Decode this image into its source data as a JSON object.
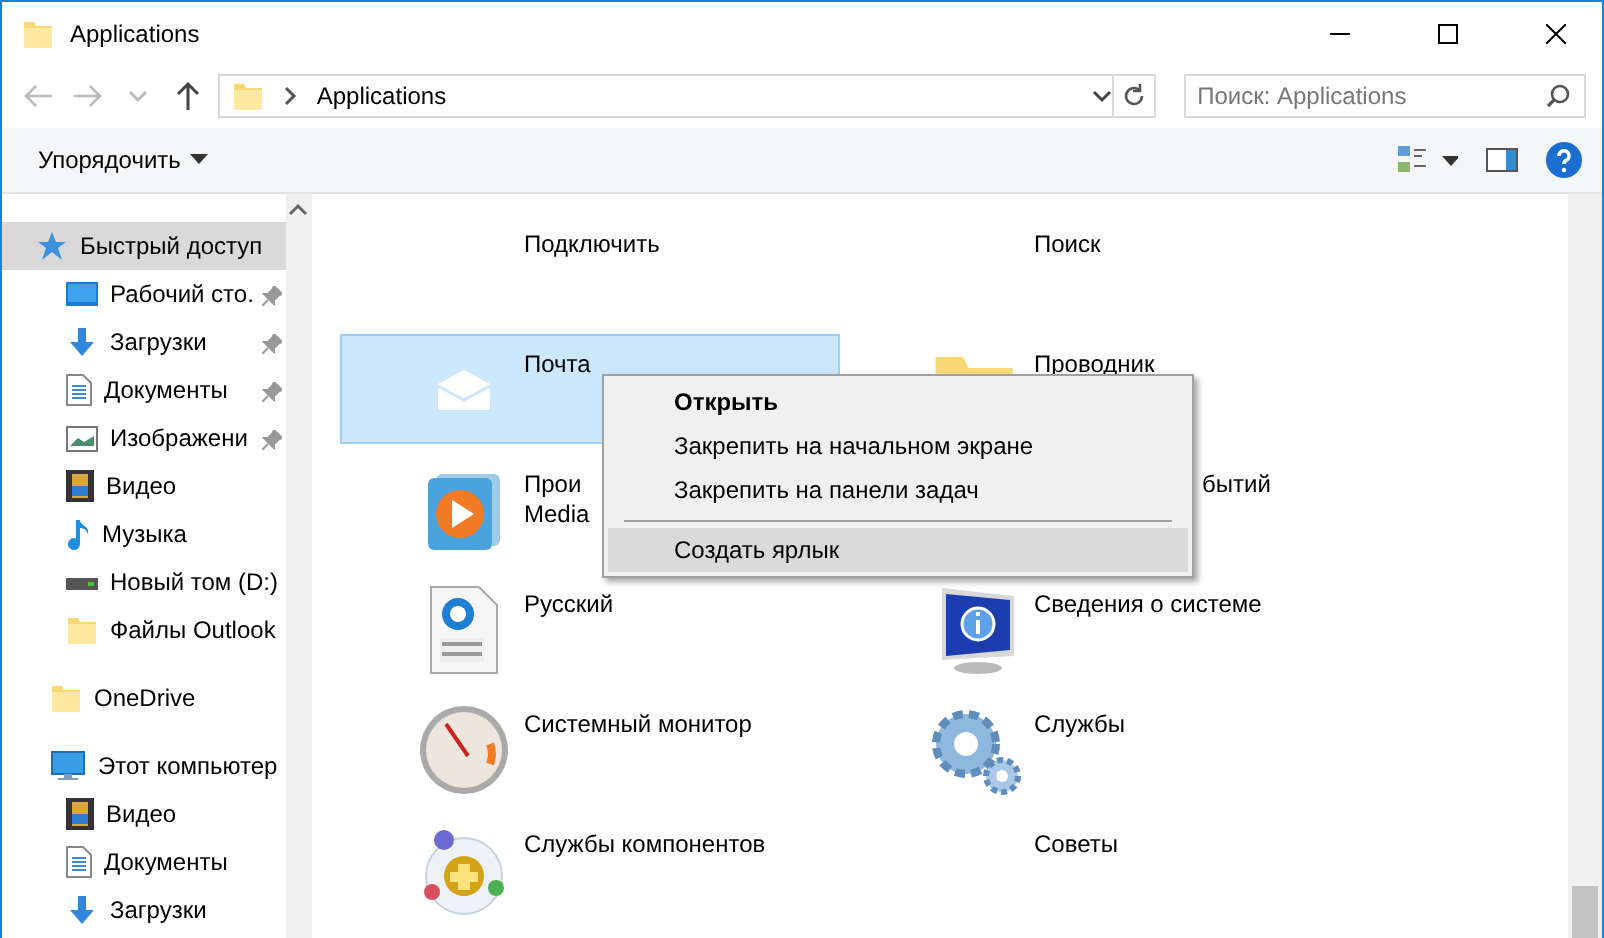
{
  "window": {
    "title": "Applications"
  },
  "address": {
    "path": "Applications",
    "search_placeholder": "Поиск: Applications"
  },
  "toolbar": {
    "organize": "Упорядочить"
  },
  "sidebar": {
    "items": [
      {
        "label": "Быстрый доступ",
        "selected": true,
        "children": [
          {
            "label": "Рабочий сто.",
            "pinned": true,
            "selected": false
          },
          {
            "label": "Загрузки",
            "pinned": true,
            "selected": false
          },
          {
            "label": "Документы",
            "pinned": true,
            "selected": false
          },
          {
            "label": "Изображени",
            "pinned": true,
            "selected": false
          },
          {
            "label": "Видео",
            "pinned": false,
            "selected": false
          },
          {
            "label": "Музыка",
            "pinned": false,
            "selected": false
          },
          {
            "label": "Новый том (D:)",
            "pinned": false,
            "selected": false
          },
          {
            "label": "Файлы Outlook",
            "pinned": false,
            "selected": false
          }
        ]
      },
      {
        "label": "OneDrive",
        "selected": false
      },
      {
        "label": "Этот компьютер",
        "selected": false,
        "children": [
          {
            "label": "Видео",
            "pinned": false,
            "selected": false
          },
          {
            "label": "Документы",
            "pinned": false,
            "selected": false
          },
          {
            "label": "Загрузки",
            "pinned": false,
            "selected": false
          }
        ]
      }
    ]
  },
  "items": [
    {
      "lines": [
        "Подключить"
      ],
      "selected": false
    },
    {
      "lines": [
        "Поиск"
      ],
      "selected": false
    },
    {
      "lines": [
        "Почта"
      ],
      "selected": true
    },
    {
      "lines": [
        "Проводник"
      ],
      "selected": false
    },
    {
      "lines": [
        "Прои",
        "Media"
      ],
      "selected": false
    },
    {
      "lines": [
        "бытий"
      ],
      "kind": "covered",
      "selected": false
    },
    {
      "lines": [
        "Русский"
      ],
      "selected": false
    },
    {
      "lines": [
        "Сведения о системе"
      ],
      "selected": false
    },
    {
      "lines": [
        "Системный монитор"
      ],
      "selected": false
    },
    {
      "lines": [
        "Службы"
      ],
      "selected": false
    },
    {
      "lines": [
        "Службы компонентов"
      ],
      "selected": false
    },
    {
      "lines": [
        "Советы"
      ],
      "selected": false
    }
  ],
  "context_menu": {
    "items": [
      {
        "label": "Открыть",
        "kind": "default",
        "highlighted": false
      },
      {
        "label": "Закрепить на начальном экране",
        "kind": "normal",
        "highlighted": false
      },
      {
        "label": "Закрепить на панели задач",
        "kind": "normal",
        "highlighted": false
      },
      {
        "kind": "separator"
      },
      {
        "label": "Создать ярлык",
        "kind": "normal",
        "highlighted": true
      }
    ]
  }
}
